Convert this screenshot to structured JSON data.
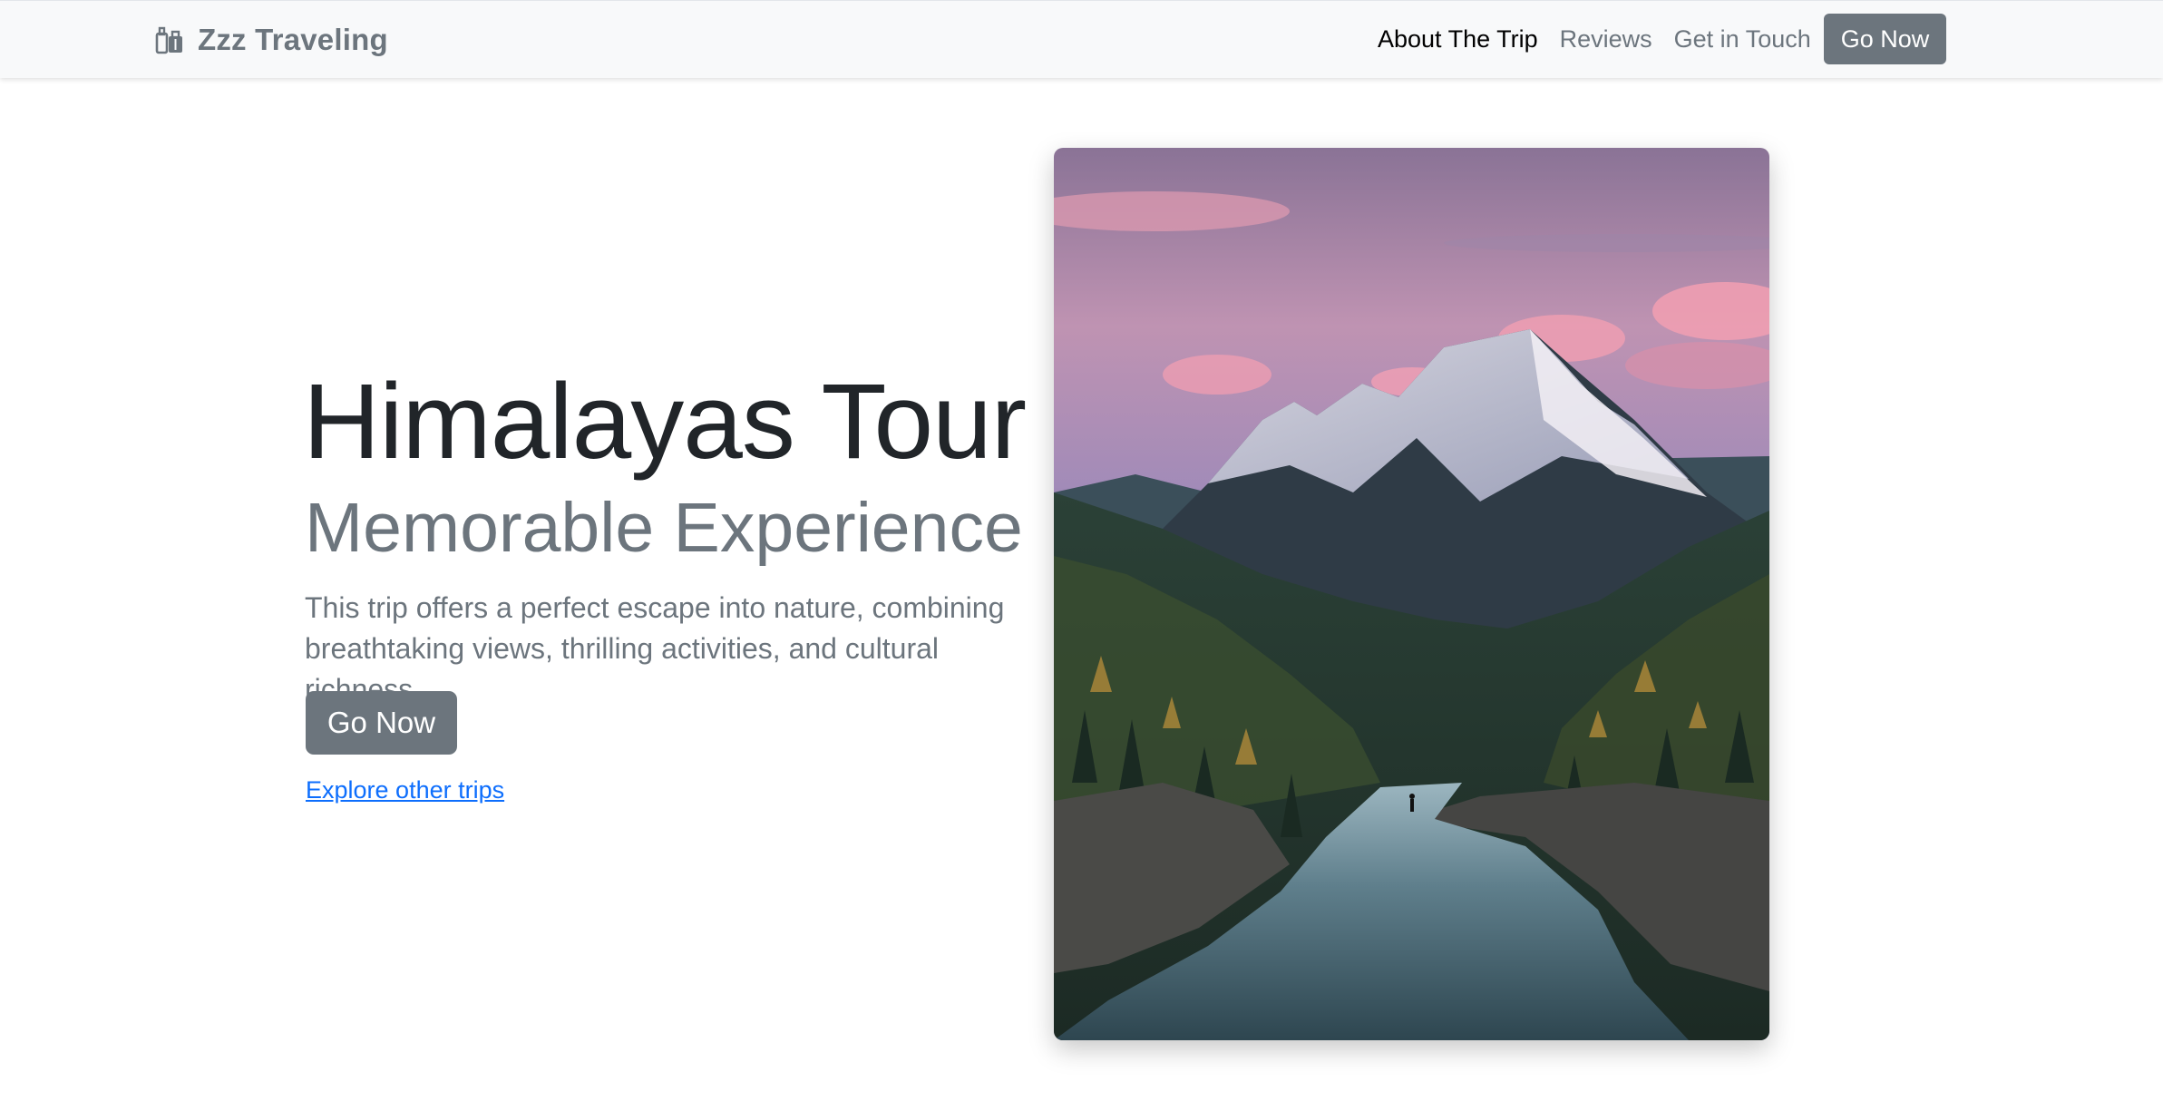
{
  "brand": {
    "name": "Zzz Traveling",
    "icon": "luggage-icon"
  },
  "nav": {
    "links": [
      {
        "label": "About The Trip",
        "active": true
      },
      {
        "label": "Reviews",
        "active": false
      },
      {
        "label": "Get in Touch",
        "active": false
      }
    ],
    "cta_label": "Go Now"
  },
  "hero": {
    "title": "Himalayas Tour",
    "subtitle": "Memorable Experience",
    "description": "This trip offers a perfect escape into nature, combining breathtaking views, thrilling activities, and cultural richness.",
    "button_label": "Go Now",
    "link_label": "Explore other trips",
    "image_alt": "Snow-capped mountain above a forested valley with a river at dusk"
  },
  "colors": {
    "navbar_bg": "#f8f9fa",
    "muted": "#6c757d",
    "heading": "#212529",
    "link": "#0d6efd",
    "button_bg": "#6c757d"
  }
}
